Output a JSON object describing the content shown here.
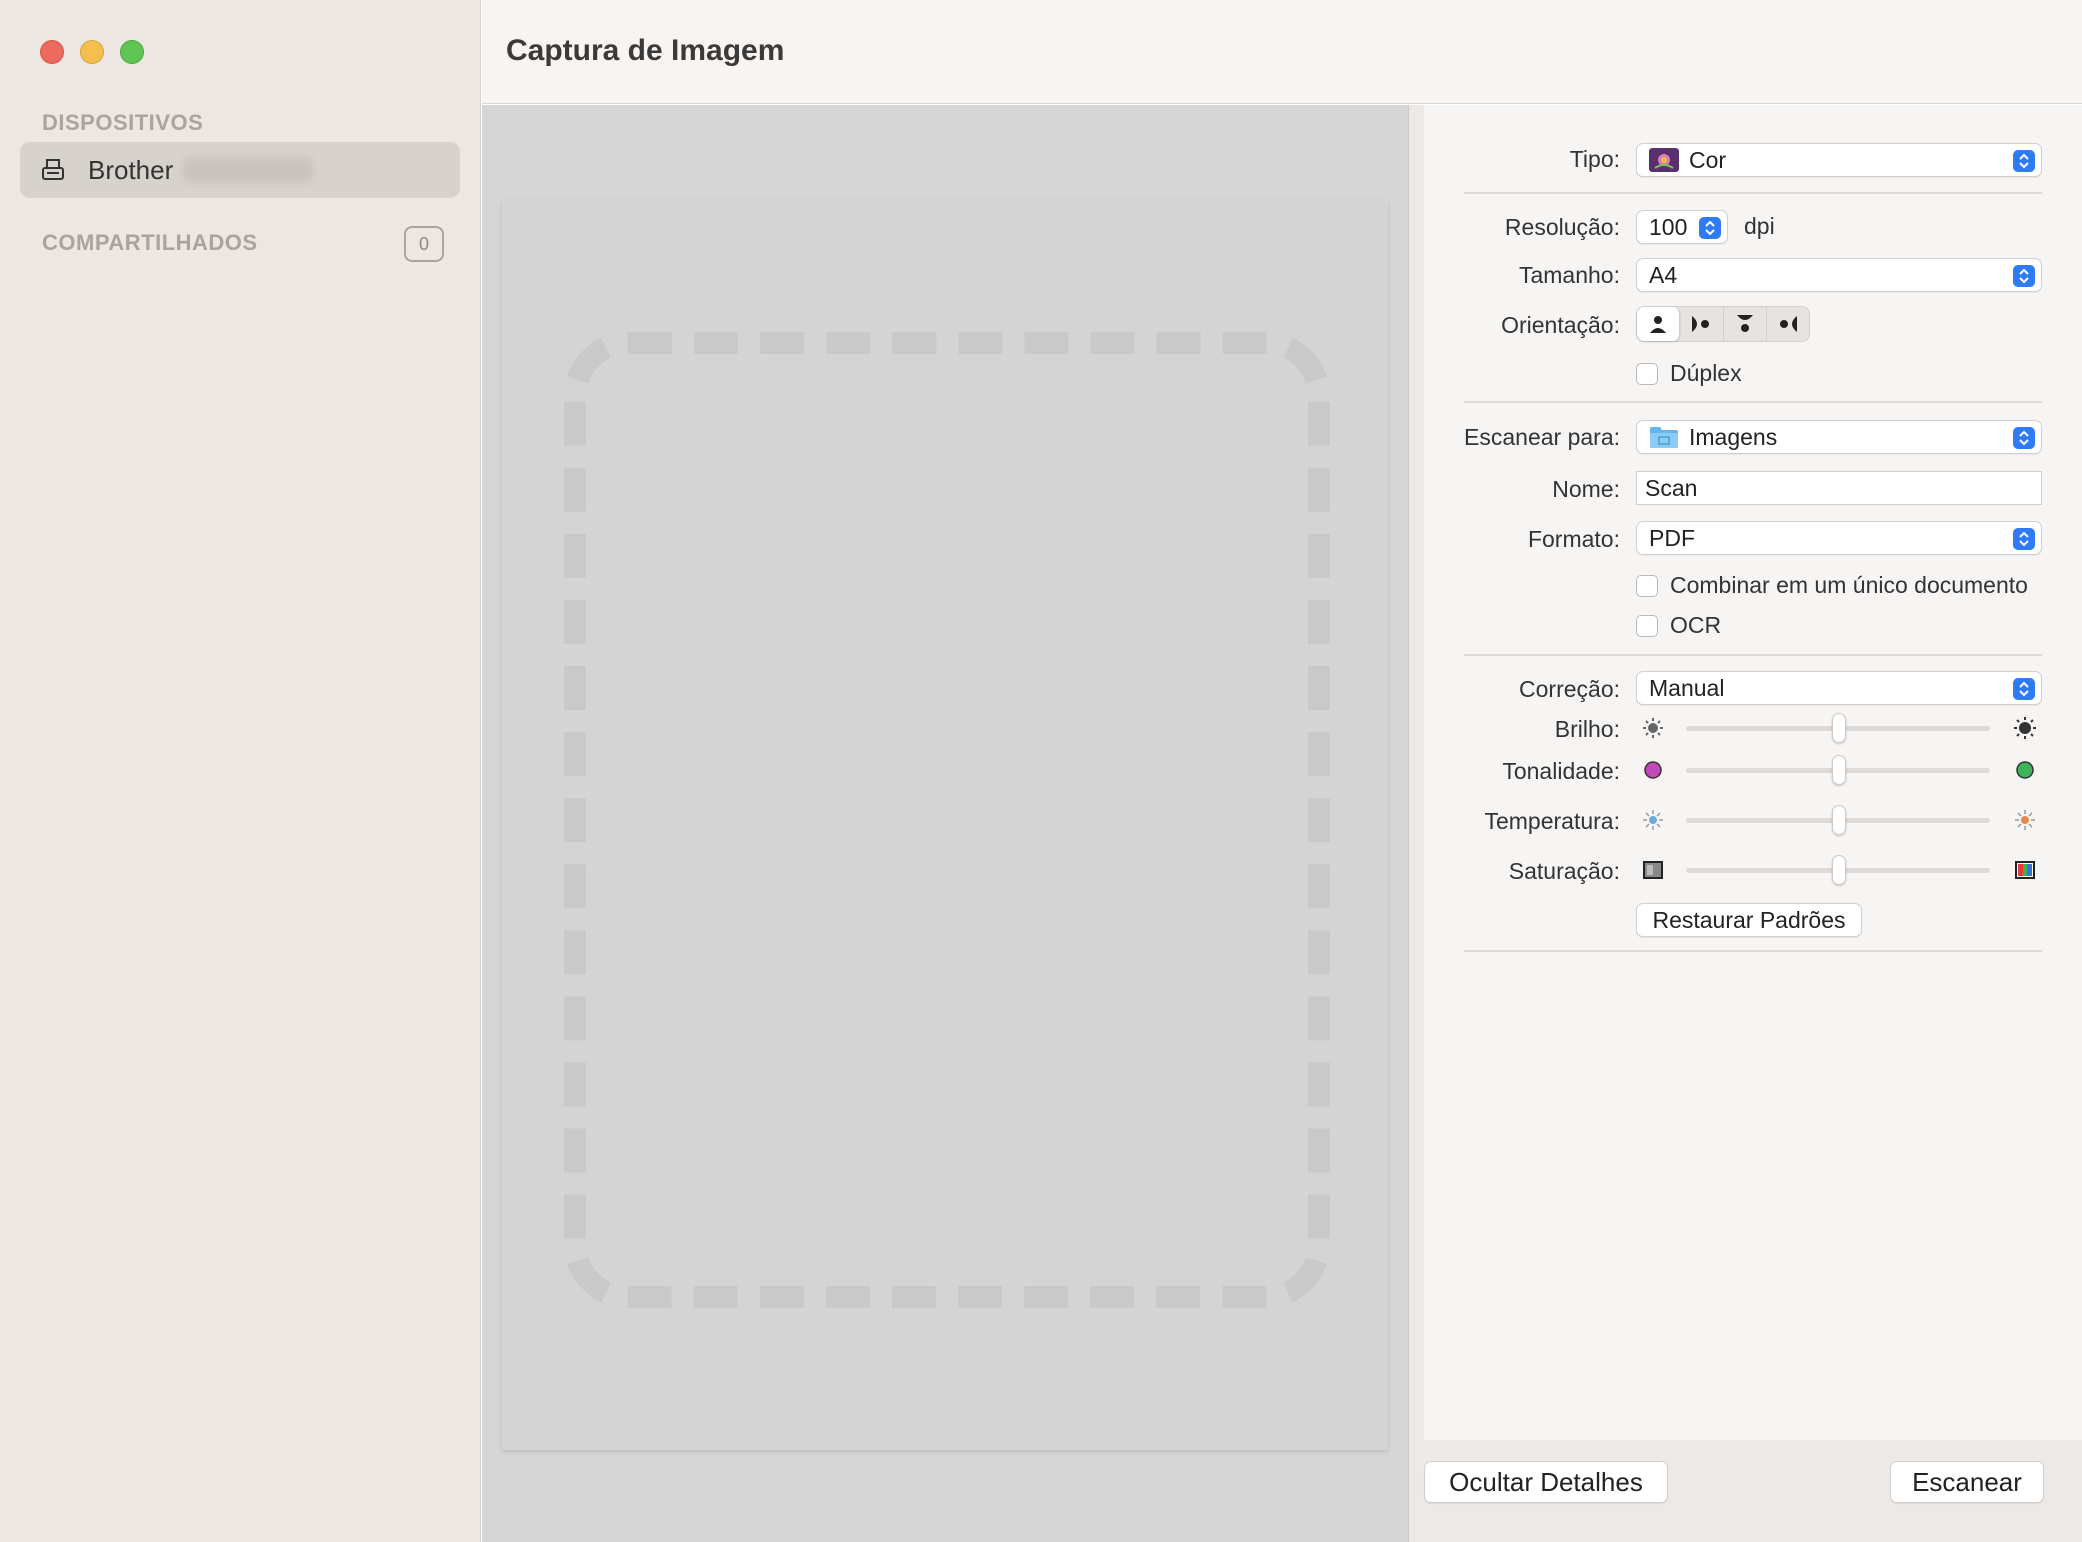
{
  "window": {
    "title": "Captura de Imagem"
  },
  "sidebar": {
    "devices_label": "DISPOSITIVOS",
    "device_name": "Brother",
    "shared_label": "COMPARTILHADOS",
    "shared_count": "0"
  },
  "settings": {
    "type_label": "Tipo:",
    "type_value": "Cor",
    "resolution_label": "Resolução:",
    "resolution_value": "100",
    "resolution_unit": "dpi",
    "size_label": "Tamanho:",
    "size_value": "A4",
    "orientation_label": "Orientação:",
    "duplex_label": "Dúplex",
    "scan_to_label": "Escanear para:",
    "scan_to_value": "Imagens",
    "name_label": "Nome:",
    "name_value": "Scan",
    "format_label": "Formato:",
    "format_value": "PDF",
    "combine_label": "Combinar em um único documento",
    "ocr_label": "OCR",
    "correction_label": "Correção:",
    "correction_value": "Manual",
    "brightness_label": "Brilho:",
    "brightness_level": 0.5,
    "tint_label": "Tonalidade:",
    "tint_level": 0.5,
    "temperature_label": "Temperatura:",
    "temperature_level": 0.5,
    "saturation_label": "Saturação:",
    "saturation_level": 0.5,
    "restore_button": "Restaurar Padrões"
  },
  "footer": {
    "hide_details_button": "Ocultar Detalhes",
    "scan_button": "Escanear"
  },
  "colors": {
    "accent": "#2f7bf6",
    "close": "#ed6a5e",
    "minimize": "#f5bf4f",
    "maximize": "#61c554"
  }
}
